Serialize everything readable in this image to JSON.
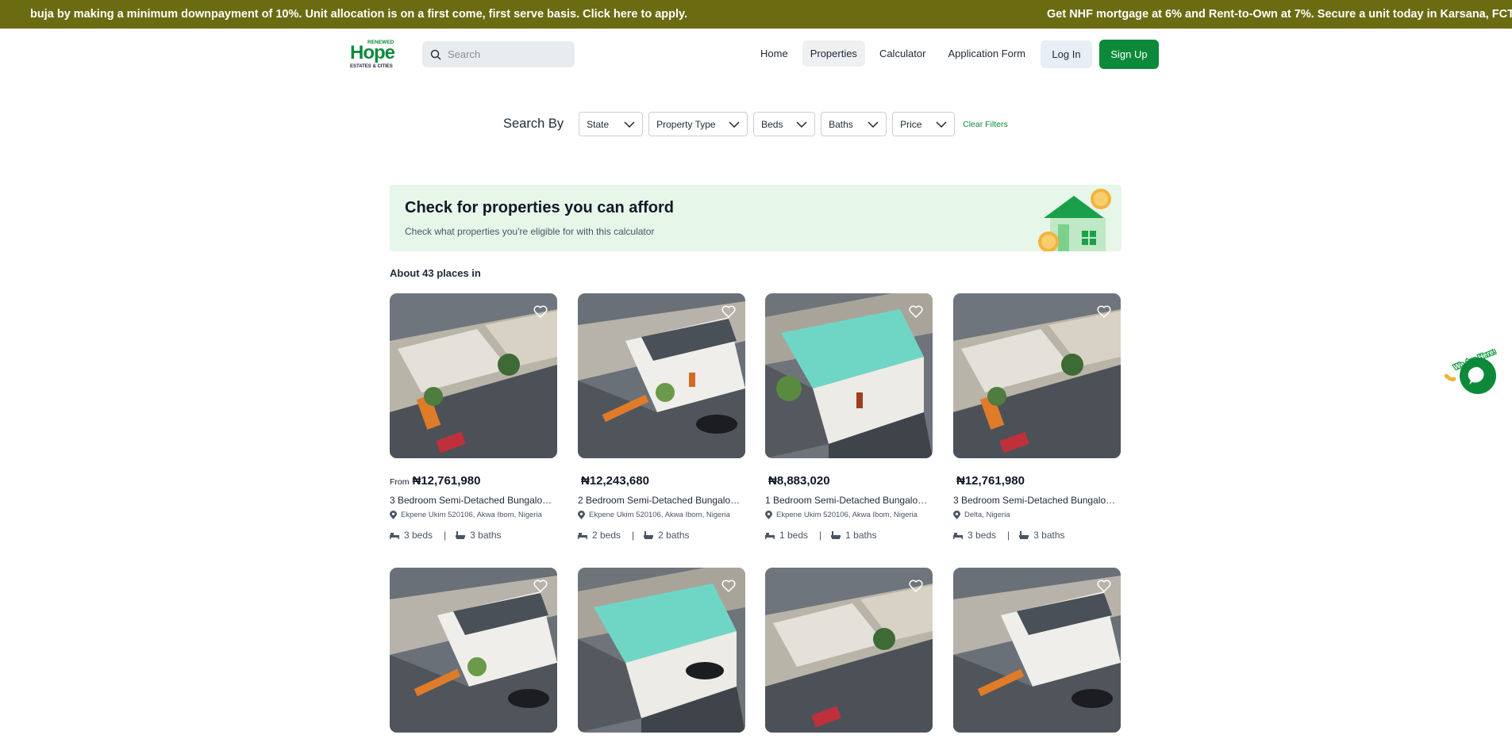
{
  "ticker": {
    "segment1": "buja by making a minimum downpayment of 10%. Unit allocation is on a first come, first serve basis. Click here to apply.",
    "segment2_pre": "Get NHF mortgage at ",
    "rate1": "6%",
    "segment2_mid": " and Rent-to-Own at ",
    "rate2": "7%",
    "segment2_post": ". Secure a unit today in Karsana, FCT A"
  },
  "logo": {
    "line1": "RENEWED",
    "line2": "Hope",
    "line3": "ESTATES & CITIES"
  },
  "search": {
    "placeholder": "Search"
  },
  "nav": {
    "home": "Home",
    "properties": "Properties",
    "calculator": "Calculator",
    "application": "Application Form",
    "login": "Log In",
    "signup": "Sign Up"
  },
  "filters": {
    "label": "Search By",
    "state": "State",
    "property_type": "Property Type",
    "beds": "Beds",
    "baths": "Baths",
    "price": "Price",
    "clear": "Clear Filters"
  },
  "banner": {
    "title": "Check for properties you can afford",
    "subtitle": "Check what properties you're eligible for with this calculator"
  },
  "results": {
    "count_text": "About 43 places in"
  },
  "listings": [
    {
      "prefix": "From",
      "price": "₦12,761,980",
      "title": "3 Bedroom Semi-Detached Bungalow…",
      "location": "Ekpene Ukim 520106, Akwa Ibom, Nigeria",
      "beds": "3 beds",
      "baths": "3 baths"
    },
    {
      "prefix": "",
      "price": "₦12,243,680",
      "title": "2 Bedroom Semi-Detached Bungalow…",
      "location": "Ekpene Ukim 520106, Akwa Ibom, Nigeria",
      "beds": "2 beds",
      "baths": "2 baths"
    },
    {
      "prefix": "",
      "price": "₦8,883,020",
      "title": "1 Bedroom Semi-Detached Bungalow…",
      "location": "Ekpene Ukim 520106, Akwa Ibom, Nigeria",
      "beds": "1 beds",
      "baths": "1 baths"
    },
    {
      "prefix": "",
      "price": "₦12,761,980",
      "title": "3 Bedroom Semi-Detached Bungalow…",
      "location": "Delta, Nigeria",
      "beds": "3 beds",
      "baths": "3 baths"
    }
  ],
  "chat": {
    "label": "We Are Here!"
  },
  "colors": {
    "ticker_bg": "#6b6b12",
    "brand_green": "#0c8a3a",
    "banner_bg": "#e6f6e8"
  }
}
